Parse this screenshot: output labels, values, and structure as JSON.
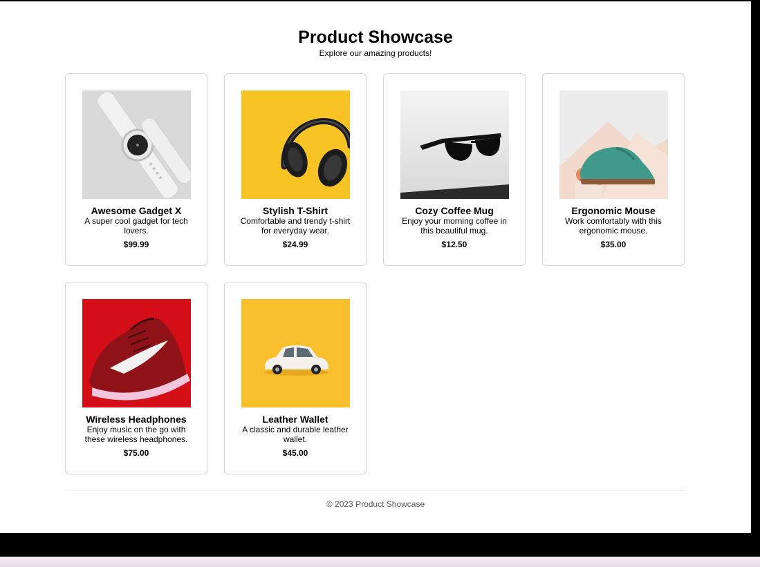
{
  "header": {
    "title": "Product Showcase",
    "subtitle": "Explore our amazing products!"
  },
  "products": [
    {
      "name": "Awesome Gadget X",
      "description": "A super cool gadget for tech lovers.",
      "price": "$99.99",
      "image": "smartwatch-photo"
    },
    {
      "name": "Stylish T-Shirt",
      "description": "Comfortable and trendy t-shirt for everyday wear.",
      "price": "$24.99",
      "image": "headphones-photo"
    },
    {
      "name": "Cozy Coffee Mug",
      "description": "Enjoy your morning coffee in this beautiful mug.",
      "price": "$12.50",
      "image": "sunglasses-photo"
    },
    {
      "name": "Ergonomic Mouse",
      "description": "Work comfortably with this ergonomic mouse.",
      "price": "$35.00",
      "image": "shoe-photo"
    },
    {
      "name": "Wireless Headphones",
      "description": "Enjoy music on the go with these wireless headphones.",
      "price": "$75.00",
      "image": "sneaker-photo"
    },
    {
      "name": "Leather Wallet",
      "description": "A classic and durable leather wallet.",
      "price": "$45.00",
      "image": "toy-car-photo"
    }
  ],
  "footer": {
    "text": "© 2023 Product Showcase"
  }
}
